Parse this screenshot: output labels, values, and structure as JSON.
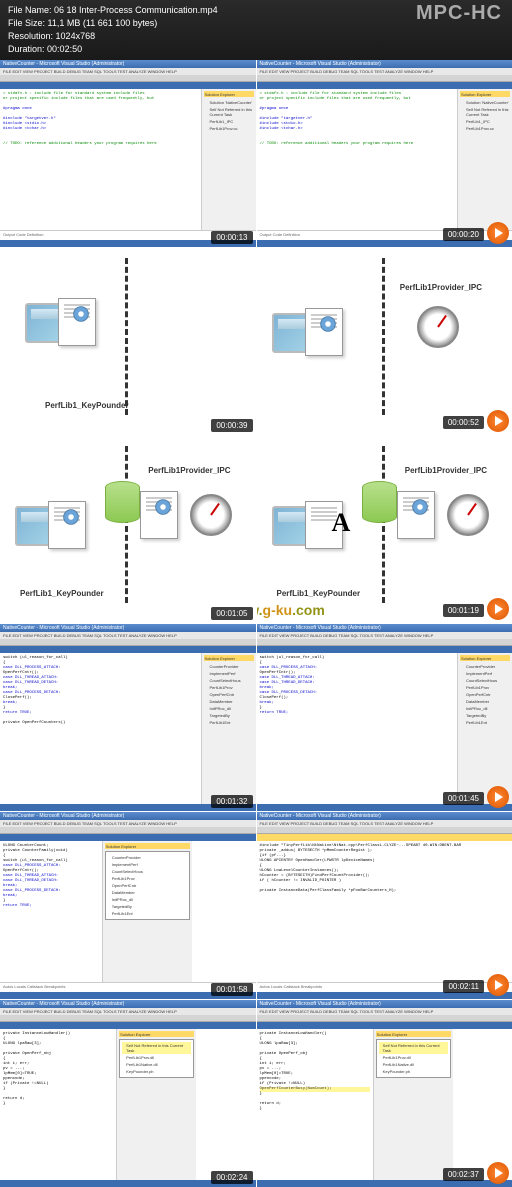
{
  "app": {
    "title": "MPC-HC"
  },
  "file_info": {
    "name_label": "File Name:",
    "name": "06 18 Inter-Process Communication.mp4",
    "size_label": "File Size:",
    "size": "11,1 MB (11 661 100 bytes)",
    "resolution_label": "Resolution:",
    "resolution": "1024x768",
    "duration_label": "Duration:",
    "duration": "00:02:50"
  },
  "watermark": {
    "part1": "www.",
    "part2": "g-ku",
    "part3": ".com"
  },
  "vs": {
    "title": "NativeCounter - Microsoft Visual Studio (Administrator)",
    "menu": "FILE  EDIT  VIEW  PROJECT  BUILD  DEBUG  TEAM  SQL  TOOLS  TEST  ANALYZE  WINDOW  HELP",
    "side_title": "Solution Explorer",
    "side_items": [
      "Solution 'NativeCounter'",
      "Self Not Referred in this Current Task",
      "PerfLib1_IPC",
      "PerfLib1Prov.cc"
    ],
    "code1_l1": "= stdafx.h : include file for standard system include files",
    "code1_l2": "or project specific include files that are used frequently, but",
    "code1_l3": "#pragma once",
    "code1_l4": "#include \"targetver.h\"",
    "code1_l5": "#include <stdio.h>",
    "code1_l6": "#include <tchar.h>",
    "code1_l7": "// TODO: reference additional headers your program requires here",
    "code2_l1": "switch (ul_reason_for_call)",
    "code2_l2": "{",
    "code2_l3": "case DLL_PROCESS_ATTACH:",
    "code2_l4": "    OpenPerfCntr();",
    "code2_l5": "",
    "code2_l6": "case DLL_THREAD_ATTACH:",
    "code2_l7": "case DLL_THREAD_DETACH:",
    "code2_l8": "    break;",
    "code2_l9": "case DLL_PROCESS_DETACH:",
    "code2_l10": "    ClosePerf();",
    "code2_l11": "    break;",
    "code2_l12": "}",
    "code2_l13": "return TRUE;",
    "code2_l14": "private OpenPerfCounters()",
    "code3_l1": "ULONG CounterCount;",
    "code3_l2": "private CounterFamily(void)",
    "code3_l3": "{",
    "code3_l4": "    switch (ul_reason_for_call)",
    "code3_l5": "    case DLL_PROCESS_ATTACH:",
    "code3_l6": "        OpenPerfCntr();",
    "code3_l7": "    case DLL_THREAD_ATTACH:",
    "code3_l8": "    case DLL_THREAD_DETACH:",
    "code3_l9": "        break;",
    "code3_l10": "    case DLL_PROCESS_DETACH:",
    "code3_l11": "        break;",
    "code3_l12": "}",
    "code3_l13": "return TRUE;",
    "code4_l1": "#include \"TinyPerfLib\\NtNative\\NtNat.cpp\\PerfClassL.CLYZE~...SPEABT 40.WIN:DBENT.BAR",
    "code4_l2": "private _addus( BYTESECTH  *pMemCounterRegist );",
    "code4_l3": "{if (pf...}",
    "code4_l4": "",
    "code4_l5": "ULONG APIENTRY OpenHandler(LPWSTR lpDeviceNames)",
    "code4_l6": "{",
    "code4_l7": "    ULONG LowLevelCounterInstances();",
    "code4_l8": "    hCounter = (BYTESECTH)FindPerfCountProvider();",
    "code4_l9": "    if ( hCounter != INVALID_POINTER )",
    "code4_l10": "    private InstanceData(PerfClassFamily *pFooBarCounters_H);",
    "code5_l1": "private InstanceLowHandler()",
    "code5_l2": "{",
    "code5_l3": "    ULONG lpaRaw[3];",
    "code5_l4": "    private OpenPerf_obj",
    "code5_l5": "    {",
    "code5_l6": "        int i; err;",
    "code5_l7": "        pv = ...;",
    "code5_l8": "        lpMem[0]=TRUE;",
    "code5_l9": "        ppencode;",
    "code5_l10": "        if (Private !=NULL)",
    "code5_l11": "          OpenPerfCounterBusy(NumCount);",
    "code5_l12": "    }",
    "code5_l13": "    return d;",
    "code5_l14": "}",
    "tree_t": "Solution Explorer",
    "tree1": "Self Not Referred in this Current Task",
    "tree2": "PerfLib1Prov.dll",
    "tree3": "PerfLib1Native.dll",
    "tree4": "KeyPounder.ph",
    "tree_side1": "CounterProvider",
    "tree_side2": "ImplementPerf",
    "tree_side3": "CountSelectHous",
    "tree_side4": "PerfLib1Prov",
    "tree_side5": "OpenPerfCntr",
    "tree_side6": "DataMember",
    "tree_side7": "InitPRoc_dll",
    "tree_side8": "TargetedBy",
    "tree_side9": "PerfLib1Ent",
    "debug_tab": "Autos Locals Callstack Breakpoints",
    "bottom_panel": "Output  Code Definition"
  },
  "diag": {
    "label_kp": "PerfLib1_KeyPounder",
    "label_ipc": "PerfLib1Provider_IPC",
    "letter_a": "A"
  },
  "thumbs": [
    {
      "ts": "00:00:13"
    },
    {
      "ts": "00:00:20"
    },
    {
      "ts": "00:00:39"
    },
    {
      "ts": "00:00:52"
    },
    {
      "ts": "00:01:05"
    },
    {
      "ts": "00:01:19"
    },
    {
      "ts": "00:01:32"
    },
    {
      "ts": "00:01:45"
    },
    {
      "ts": "00:01:58"
    },
    {
      "ts": "00:02:11"
    },
    {
      "ts": "00:02:24"
    },
    {
      "ts": "00:02:37"
    }
  ]
}
